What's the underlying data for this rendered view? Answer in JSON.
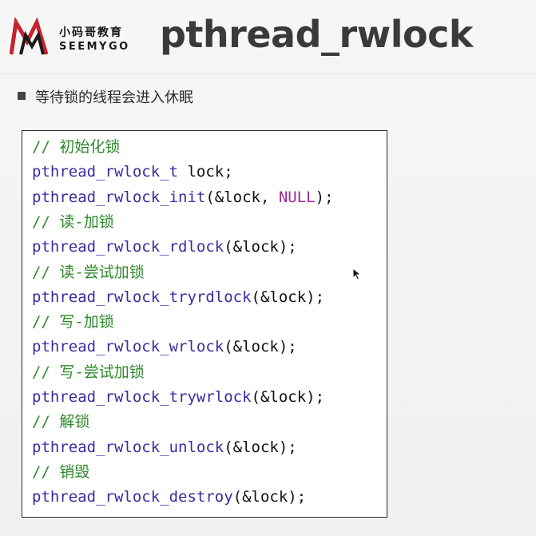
{
  "header": {
    "logo_cn": "小码哥教育",
    "logo_en": "SEEMYGO",
    "title": "pthread_rwlock"
  },
  "bullet": {
    "text": "等待锁的线程会进入休眠"
  },
  "code": {
    "lines": [
      {
        "comment": "// 初始化锁"
      },
      {
        "func": "pthread_rwlock_t",
        "rest": " lock;"
      },
      {
        "func": "pthread_rwlock_init",
        "rest": "(&lock, ",
        "keyword": "NULL",
        "tail": ");"
      },
      {
        "comment": "// 读-加锁"
      },
      {
        "func": "pthread_rwlock_rdlock",
        "rest": "(&lock);"
      },
      {
        "comment": "// 读-尝试加锁"
      },
      {
        "func": "pthread_rwlock_tryrdlock",
        "rest": "(&lock);"
      },
      {
        "comment": "// 写-加锁"
      },
      {
        "func": "pthread_rwlock_wrlock",
        "rest": "(&lock);"
      },
      {
        "comment": "// 写-尝试加锁"
      },
      {
        "func": "pthread_rwlock_trywrlock",
        "rest": "(&lock);"
      },
      {
        "comment": "// 解锁"
      },
      {
        "func": "pthread_rwlock_unlock",
        "rest": "(&lock);"
      },
      {
        "comment": "// 销毁"
      },
      {
        "func": "pthread_rwlock_destroy",
        "rest": "(&lock);"
      }
    ]
  },
  "colors": {
    "comment": "#2e8a2a",
    "function": "#3b2ba3",
    "keyword": "#a2279a",
    "logo_red": "#c8232c"
  },
  "icons": {
    "logo": "seemygo-logo-icon",
    "cursor": "mouse-pointer-icon",
    "bullet": "square-bullet-icon"
  }
}
